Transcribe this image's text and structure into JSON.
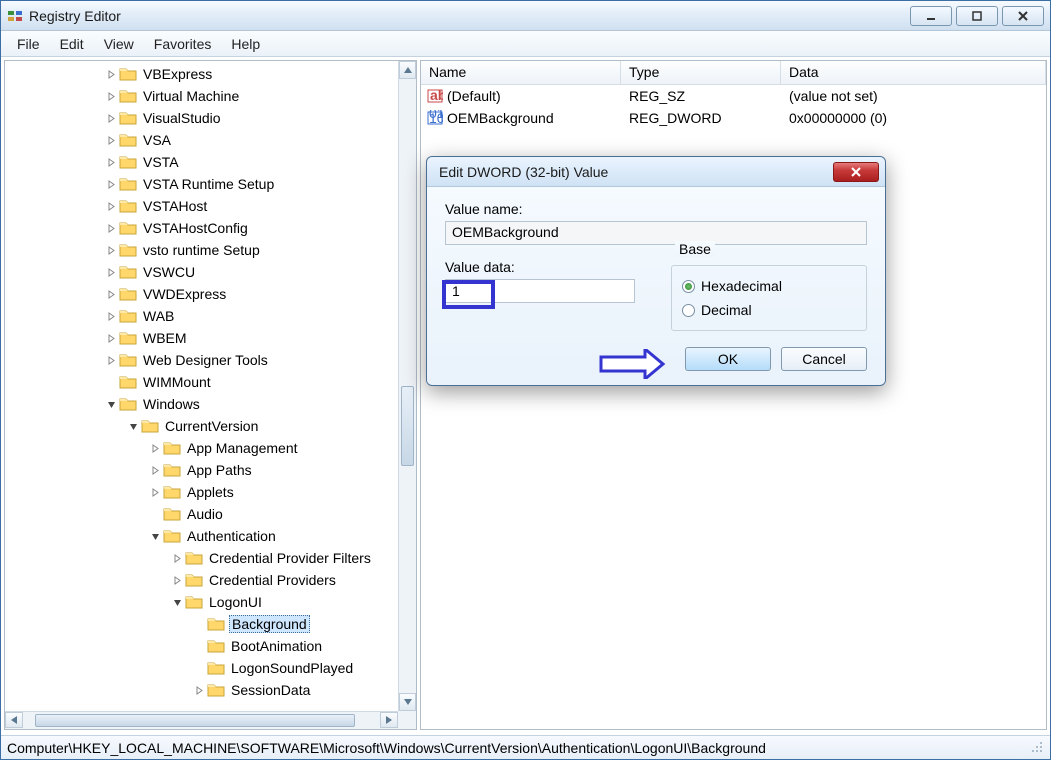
{
  "window": {
    "title": "Registry Editor"
  },
  "menu": [
    "File",
    "Edit",
    "View",
    "Favorites",
    "Help"
  ],
  "tree": [
    {
      "indent": 0,
      "exp": "closed",
      "label": "VBExpress"
    },
    {
      "indent": 0,
      "exp": "closed",
      "label": "Virtual Machine"
    },
    {
      "indent": 0,
      "exp": "closed",
      "label": "VisualStudio"
    },
    {
      "indent": 0,
      "exp": "closed",
      "label": "VSA"
    },
    {
      "indent": 0,
      "exp": "closed",
      "label": "VSTA"
    },
    {
      "indent": 0,
      "exp": "closed",
      "label": "VSTA Runtime Setup"
    },
    {
      "indent": 0,
      "exp": "closed",
      "label": "VSTAHost"
    },
    {
      "indent": 0,
      "exp": "closed",
      "label": "VSTAHostConfig"
    },
    {
      "indent": 0,
      "exp": "closed",
      "label": "vsto runtime Setup"
    },
    {
      "indent": 0,
      "exp": "closed",
      "label": "VSWCU"
    },
    {
      "indent": 0,
      "exp": "closed",
      "label": "VWDExpress"
    },
    {
      "indent": 0,
      "exp": "closed",
      "label": "WAB"
    },
    {
      "indent": 0,
      "exp": "closed",
      "label": "WBEM"
    },
    {
      "indent": 0,
      "exp": "closed",
      "label": "Web Designer Tools"
    },
    {
      "indent": 0,
      "exp": "none",
      "label": "WIMMount"
    },
    {
      "indent": 0,
      "exp": "open",
      "label": "Windows"
    },
    {
      "indent": 1,
      "exp": "open",
      "label": "CurrentVersion"
    },
    {
      "indent": 2,
      "exp": "closed",
      "label": "App Management"
    },
    {
      "indent": 2,
      "exp": "closed",
      "label": "App Paths"
    },
    {
      "indent": 2,
      "exp": "closed",
      "label": "Applets"
    },
    {
      "indent": 2,
      "exp": "none",
      "label": "Audio"
    },
    {
      "indent": 2,
      "exp": "open",
      "label": "Authentication"
    },
    {
      "indent": 3,
      "exp": "closed",
      "label": "Credential Provider Filters"
    },
    {
      "indent": 3,
      "exp": "closed",
      "label": "Credential Providers"
    },
    {
      "indent": 3,
      "exp": "open",
      "label": "LogonUI"
    },
    {
      "indent": 4,
      "exp": "none",
      "label": "Background",
      "selected": true
    },
    {
      "indent": 4,
      "exp": "none",
      "label": "BootAnimation"
    },
    {
      "indent": 4,
      "exp": "none",
      "label": "LogonSoundPlayed"
    },
    {
      "indent": 4,
      "exp": "closed",
      "label": "SessionData"
    }
  ],
  "list": {
    "columns": [
      "Name",
      "Type",
      "Data"
    ],
    "rows": [
      {
        "icon": "string",
        "name": "(Default)",
        "type": "REG_SZ",
        "data": "(value not set)"
      },
      {
        "icon": "binary",
        "name": "OEMBackground",
        "type": "REG_DWORD",
        "data": "0x00000000 (0)"
      }
    ]
  },
  "dialog": {
    "title": "Edit DWORD (32-bit) Value",
    "value_name_label": "Value name:",
    "value_name": "OEMBackground",
    "value_data_label": "Value data:",
    "value_data": "1",
    "base_label": "Base",
    "radio_hex": "Hexadecimal",
    "radio_dec": "Decimal",
    "ok": "OK",
    "cancel": "Cancel"
  },
  "status": "Computer\\HKEY_LOCAL_MACHINE\\SOFTWARE\\Microsoft\\Windows\\CurrentVersion\\Authentication\\LogonUI\\Background"
}
